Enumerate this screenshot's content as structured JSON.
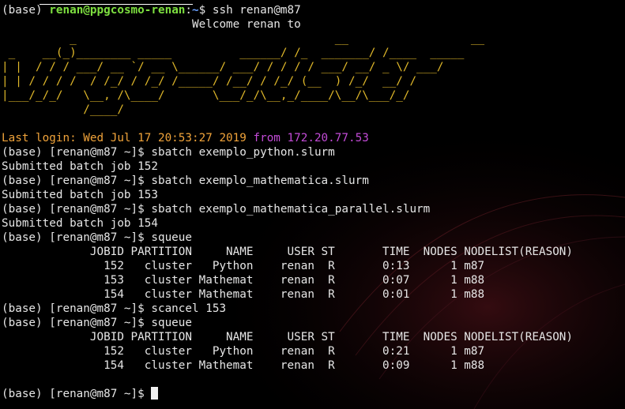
{
  "lines": [
    {
      "segs": [
        {
          "t": "(base) ",
          "c": "c-white"
        },
        {
          "t": "renan@ppgcosmo-renan",
          "c": "c-green"
        },
        {
          "t": ":",
          "c": "c-white"
        },
        {
          "t": "~",
          "c": "c-blue"
        },
        {
          "t": "$ ssh renan@m87",
          "c": "c-white"
        }
      ]
    },
    {
      "segs": [
        {
          "t": "                            Welcome renan to",
          "c": "c-white"
        }
      ]
    },
    {
      "segs": [
        {
          "t": "          _                                      __                  __",
          "c": "banner"
        }
      ]
    },
    {
      "segs": [
        {
          "t": " _    __(_)________ _____          ______/ /_  _______/ /____  _____",
          "c": "banner"
        }
      ]
    },
    {
      "segs": [
        {
          "t": "| |  / / / ___/ __ `/ __ \\______/ ___/ / / / / ___/ __/ _ \\/ ___/",
          "c": "banner"
        }
      ]
    },
    {
      "segs": [
        {
          "t": "| | / / / /  / /_/ / /_/ /_____/ /__/ / /_/ (__  ) /_/  __/ /",
          "c": "banner"
        }
      ]
    },
    {
      "segs": [
        {
          "t": "|___/_/_/   \\__, /\\____/       \\___/_/\\__,_/____/\\__/\\___/_/",
          "c": "banner"
        }
      ]
    },
    {
      "segs": [
        {
          "t": "            /____/",
          "c": "banner"
        }
      ]
    },
    {
      "segs": [
        {
          "t": "",
          "c": "c-white"
        }
      ]
    },
    {
      "segs": [
        {
          "t": "Last login: Wed Jul 17 20:53:27 2019 ",
          "c": "c-orange"
        },
        {
          "t": "from 172.20.77.53",
          "c": "c-purple"
        }
      ]
    },
    {
      "segs": [
        {
          "t": "(base) [renan@m87 ~]$ sbatch exemplo_python.slurm",
          "c": "c-white"
        }
      ]
    },
    {
      "segs": [
        {
          "t": "Submitted batch job 152",
          "c": "c-white"
        }
      ]
    },
    {
      "segs": [
        {
          "t": "(base) [renan@m87 ~]$ sbatch exemplo_mathematica.slurm",
          "c": "c-white"
        }
      ]
    },
    {
      "segs": [
        {
          "t": "Submitted batch job 153",
          "c": "c-white"
        }
      ]
    },
    {
      "segs": [
        {
          "t": "(base) [renan@m87 ~]$ sbatch exemplo_mathematica_parallel.slurm",
          "c": "c-white"
        }
      ]
    },
    {
      "segs": [
        {
          "t": "Submitted batch job 154",
          "c": "c-white"
        }
      ]
    },
    {
      "segs": [
        {
          "t": "(base) [renan@m87 ~]$ squeue",
          "c": "c-white"
        }
      ]
    },
    {
      "segs": [
        {
          "t": "             JOBID PARTITION     NAME     USER ST       TIME  NODES NODELIST(REASON)",
          "c": "c-white"
        }
      ]
    },
    {
      "segs": [
        {
          "t": "               152   cluster   Python    renan  R       0:13      1 m87",
          "c": "c-white"
        }
      ]
    },
    {
      "segs": [
        {
          "t": "               153   cluster Mathemat    renan  R       0:07      1 m88",
          "c": "c-white"
        }
      ]
    },
    {
      "segs": [
        {
          "t": "               154   cluster Mathemat    renan  R       0:01      1 m88",
          "c": "c-white"
        }
      ]
    },
    {
      "segs": [
        {
          "t": "(base) [renan@m87 ~]$ scancel 153",
          "c": "c-white"
        }
      ]
    },
    {
      "segs": [
        {
          "t": "(base) [renan@m87 ~]$ squeue",
          "c": "c-white"
        }
      ]
    },
    {
      "segs": [
        {
          "t": "             JOBID PARTITION     NAME     USER ST       TIME  NODES NODELIST(REASON)",
          "c": "c-white"
        }
      ]
    },
    {
      "segs": [
        {
          "t": "               152   cluster   Python    renan  R       0:21      1 m87",
          "c": "c-white"
        }
      ]
    },
    {
      "segs": [
        {
          "t": "               154   cluster Mathemat    renan  R       0:09      1 m88",
          "c": "c-white"
        }
      ]
    },
    {
      "segs": [
        {
          "t": "",
          "c": "c-white"
        }
      ]
    },
    {
      "segs": [
        {
          "t": "(base) [renan@m87 ~]$ ",
          "c": "c-white"
        }
      ],
      "cursor": true
    }
  ],
  "colors": {
    "background": "#000000",
    "text": "#e6e6e6",
    "prompt_user": "#7ee040",
    "prompt_path": "#6aa0ff",
    "banner": "#e0b82a",
    "last_login": "#f0a33a",
    "from_ip": "#c24bd6"
  }
}
